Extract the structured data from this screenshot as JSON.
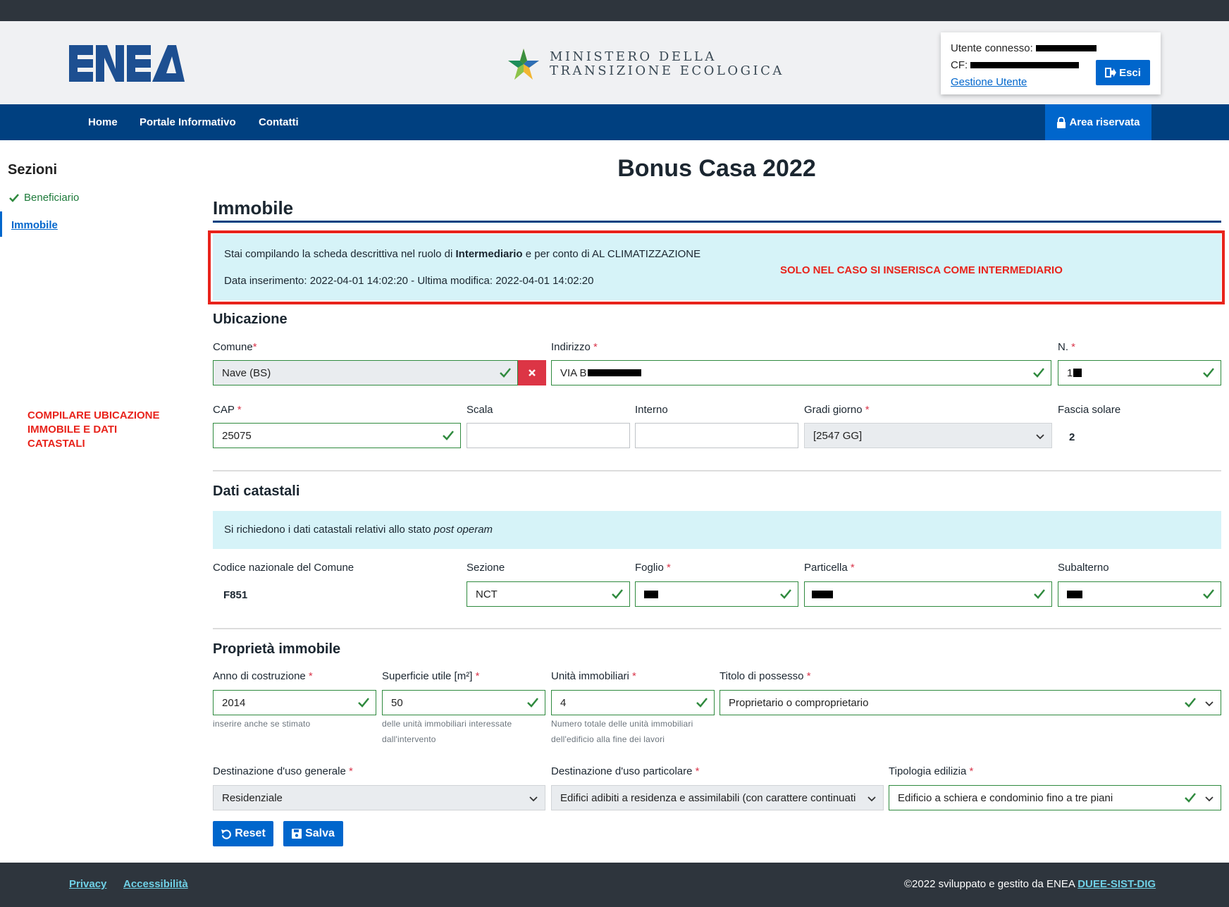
{
  "header": {
    "logo_text": "ENEA",
    "ministry_line1": "MINISTERO DELLA",
    "ministry_line2": "TRANSIZIONE ECOLOGICA",
    "user_label": "Utente connesso:",
    "cf_label": "CF:",
    "manage_user": "Gestione Utente",
    "logout_label": "Esci"
  },
  "nav": {
    "items": [
      "Home",
      "Portale Informativo",
      "Contatti"
    ],
    "reserved_area": "Area riservata"
  },
  "sidebar": {
    "title": "Sezioni",
    "items": [
      {
        "label": "Beneficiario",
        "status": "complete"
      },
      {
        "label": "Immobile",
        "status": "active"
      }
    ]
  },
  "annotations": {
    "intermediary_note": "SOLO NEL CASO SI INSERISCA COME INTERMEDIARIO",
    "fill_note_line1": "COMPILARE UBICAZIONE",
    "fill_note_line2": "IMMOBILE E DATI",
    "fill_note_line3": "CATASTALI"
  },
  "page": {
    "title": "Bonus Casa 2022",
    "section": "Immobile"
  },
  "info": {
    "role_prefix": "Stai compilando la scheda descrittiva nel ruolo di ",
    "role": "Intermediario",
    "role_suffix": " e per conto di AL CLIMATIZZAZIONE",
    "dates": "Data inserimento: 2022-04-01 14:02:20 - Ultima modifica: 2022-04-01 14:02:20"
  },
  "ubicazione": {
    "title": "Ubicazione",
    "comune": {
      "label": "Comune",
      "value": "Nave (BS)"
    },
    "indirizzo": {
      "label": "Indirizzo",
      "value": "VIA B"
    },
    "numero": {
      "label": "N.",
      "value": "1"
    },
    "cap": {
      "label": "CAP",
      "value": "25075"
    },
    "scala": {
      "label": "Scala",
      "value": ""
    },
    "interno": {
      "label": "Interno",
      "value": ""
    },
    "gradi_giorno": {
      "label": "Gradi giorno",
      "value": "[2547 GG]"
    },
    "fascia_solare": {
      "label": "Fascia solare",
      "value": "2"
    }
  },
  "catastali": {
    "title": "Dati catastali",
    "note_prefix": "Si richiedono i dati catastali relativi allo stato ",
    "note_em": "post operam",
    "codice": {
      "label": "Codice nazionale del Comune",
      "value": "F851"
    },
    "sezione": {
      "label": "Sezione",
      "value": "NCT"
    },
    "foglio": {
      "label": "Foglio"
    },
    "particella": {
      "label": "Particella"
    },
    "subalterno": {
      "label": "Subalterno"
    }
  },
  "proprieta": {
    "title": "Proprietà immobile",
    "anno": {
      "label": "Anno di costruzione",
      "value": "2014",
      "help": "inserire anche se stimato"
    },
    "superficie": {
      "label": "Superficie utile [m²]",
      "value": "50",
      "help1": "delle unità immobiliari interessate",
      "help2": "dall'intervento"
    },
    "unita": {
      "label": "Unità immobiliari",
      "value": "4",
      "help1": "Numero totale delle unità immobiliari",
      "help2": "dell'edificio alla fine dei lavori"
    },
    "titolo": {
      "label": "Titolo di possesso",
      "value": "Proprietario o comproprietario"
    },
    "dest_generale": {
      "label": "Destinazione d'uso generale",
      "value": "Residenziale"
    },
    "dest_particolare": {
      "label": "Destinazione d'uso particolare",
      "value": "Edifici adibiti a residenza e assimilabili (con carattere continuati"
    },
    "tipologia": {
      "label": "Tipologia edilizia",
      "value": "Edificio a schiera e condominio fino a tre piani"
    }
  },
  "actions": {
    "reset": "Reset",
    "save": "Salva"
  },
  "footer": {
    "privacy": "Privacy",
    "accessibility": "Accessibilità",
    "copyright": "©2022 sviluppato e gestito da ENEA ",
    "dept_link": "DUEE-SIST-DIG"
  },
  "colors": {
    "primary_nav": "#004080",
    "accent": "#0066cc",
    "valid": "#2f8a3e",
    "annotation_red": "#e8231b",
    "info_bg": "#d6f3f8"
  }
}
